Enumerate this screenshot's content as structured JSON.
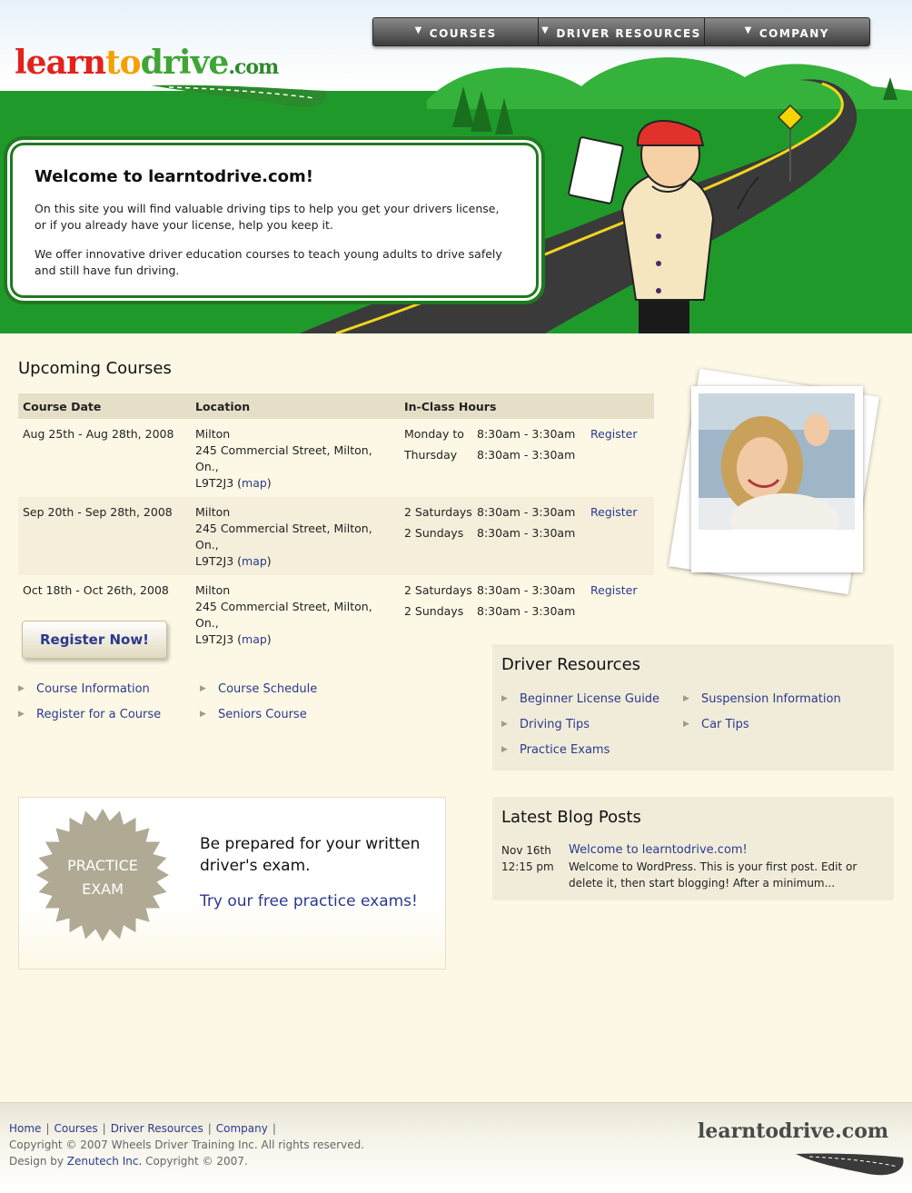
{
  "header": {
    "logo": "learntodrive.com",
    "nav": [
      {
        "label": "COURSES"
      },
      {
        "label": "DRIVER RESOURCES"
      },
      {
        "label": "COMPANY"
      }
    ],
    "welcome_title": "Welcome to learntodrive.com!",
    "welcome_p1": "On this site you will find valuable driving tips to help you get your drivers license, or if you already have your license, help you keep it.",
    "welcome_p2": "We offer innovative driver education courses to teach young adults to drive safely and still have fun driving."
  },
  "courses": {
    "title": "Upcoming Courses",
    "headers": [
      "Course Date",
      "Location",
      "In-Class Hours"
    ],
    "rows": [
      {
        "date": "Aug 25th - Aug 28th, 2008",
        "loc_city": "Milton",
        "loc_street": "245 Commercial Street, Milton, On.,",
        "loc_postal": "L9T2J3",
        "map": "map",
        "days": [
          "Monday to",
          "Thursday"
        ],
        "times": [
          "8:30am - 3:30am",
          "8:30am - 3:30am"
        ],
        "register": "Register"
      },
      {
        "date": "Sep 20th - Sep 28th, 2008",
        "loc_city": "Milton",
        "loc_street": "245 Commercial Street, Milton, On.,",
        "loc_postal": "L9T2J3",
        "map": "map",
        "days": [
          "2 Saturdays",
          "2 Sundays"
        ],
        "times": [
          "8:30am - 3:30am",
          "8:30am - 3:30am"
        ],
        "register": "Register"
      },
      {
        "date": "Oct 18th - Oct 26th, 2008",
        "loc_city": "Milton",
        "loc_street": "245 Commercial Street, Milton, On.,",
        "loc_postal": "L9T2J3",
        "map": "map",
        "days": [
          "2 Saturdays",
          "2 Sundays"
        ],
        "times": [
          "8:30am - 3:30am",
          "8:30am - 3:30am"
        ],
        "register": "Register"
      }
    ]
  },
  "register_now": "Register Now!",
  "course_links": [
    "Course Information",
    "Register for a Course",
    "Course Schedule",
    "Seniors Course"
  ],
  "driver_resources": {
    "title": "Driver Resources",
    "links_left": [
      "Beginner License Guide",
      "Driving Tips",
      "Practice Exams"
    ],
    "links_right": [
      "Suspension Information",
      "Car Tips"
    ]
  },
  "practice": {
    "badge_line1": "PRACTICE",
    "badge_line2": "EXAM",
    "line1": "Be prepared for your written driver's exam.",
    "line2": "Try our free practice exams!"
  },
  "blog": {
    "title": "Latest Blog Posts",
    "date": "Nov 16th",
    "time": "12:15 pm",
    "post_title": "Welcome to learntodrive.com!",
    "excerpt": "Welcome to WordPress. This is your first post. Edit or delete it, then start blogging! After a minimum..."
  },
  "footer": {
    "links": [
      "Home",
      "Courses",
      "Driver Resources",
      "Company"
    ],
    "copyright": "Copyright © 2007 Wheels Driver Training Inc. All rights reserved.",
    "design_prefix": "Design by ",
    "design_link": "Zenutech Inc.",
    "design_suffix": " Copyright © 2007.",
    "logo": "learntodrive.com"
  },
  "colors": {
    "grass": "#1f9a2a",
    "road": "#3a3a3a",
    "link": "#2a3a8c",
    "page_bg": "#fdf8e6"
  }
}
